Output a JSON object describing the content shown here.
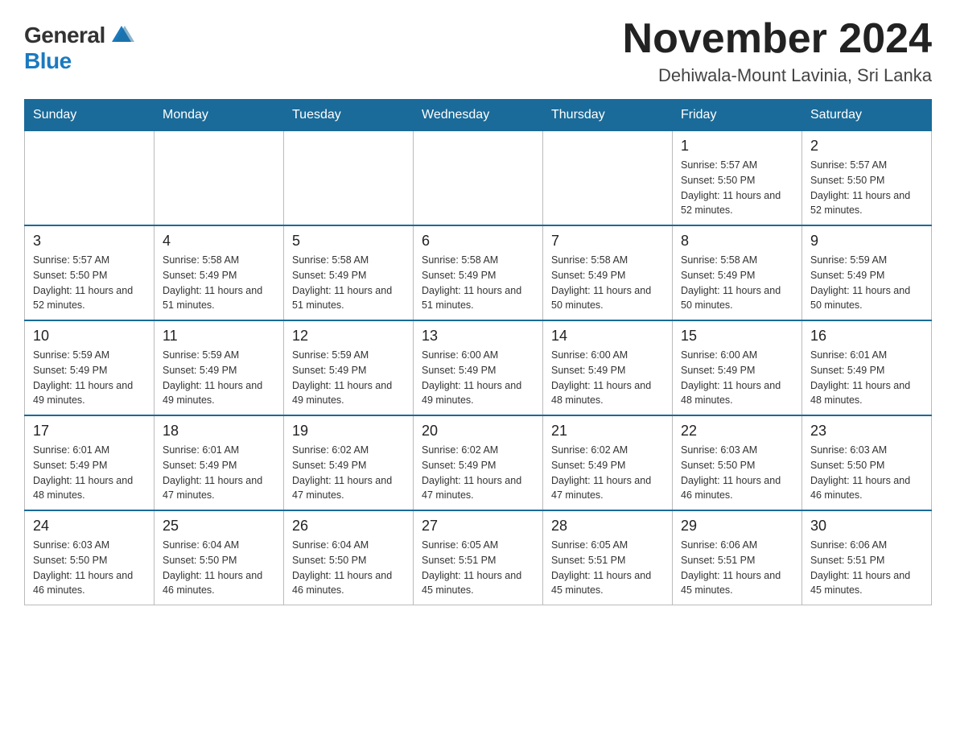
{
  "header": {
    "logo_general": "General",
    "logo_blue": "Blue",
    "month_title": "November 2024",
    "location": "Dehiwala-Mount Lavinia, Sri Lanka"
  },
  "days_of_week": [
    "Sunday",
    "Monday",
    "Tuesday",
    "Wednesday",
    "Thursday",
    "Friday",
    "Saturday"
  ],
  "weeks": [
    [
      {
        "day": "",
        "info": ""
      },
      {
        "day": "",
        "info": ""
      },
      {
        "day": "",
        "info": ""
      },
      {
        "day": "",
        "info": ""
      },
      {
        "day": "",
        "info": ""
      },
      {
        "day": "1",
        "info": "Sunrise: 5:57 AM\nSunset: 5:50 PM\nDaylight: 11 hours and 52 minutes."
      },
      {
        "day": "2",
        "info": "Sunrise: 5:57 AM\nSunset: 5:50 PM\nDaylight: 11 hours and 52 minutes."
      }
    ],
    [
      {
        "day": "3",
        "info": "Sunrise: 5:57 AM\nSunset: 5:50 PM\nDaylight: 11 hours and 52 minutes."
      },
      {
        "day": "4",
        "info": "Sunrise: 5:58 AM\nSunset: 5:49 PM\nDaylight: 11 hours and 51 minutes."
      },
      {
        "day": "5",
        "info": "Sunrise: 5:58 AM\nSunset: 5:49 PM\nDaylight: 11 hours and 51 minutes."
      },
      {
        "day": "6",
        "info": "Sunrise: 5:58 AM\nSunset: 5:49 PM\nDaylight: 11 hours and 51 minutes."
      },
      {
        "day": "7",
        "info": "Sunrise: 5:58 AM\nSunset: 5:49 PM\nDaylight: 11 hours and 50 minutes."
      },
      {
        "day": "8",
        "info": "Sunrise: 5:58 AM\nSunset: 5:49 PM\nDaylight: 11 hours and 50 minutes."
      },
      {
        "day": "9",
        "info": "Sunrise: 5:59 AM\nSunset: 5:49 PM\nDaylight: 11 hours and 50 minutes."
      }
    ],
    [
      {
        "day": "10",
        "info": "Sunrise: 5:59 AM\nSunset: 5:49 PM\nDaylight: 11 hours and 49 minutes."
      },
      {
        "day": "11",
        "info": "Sunrise: 5:59 AM\nSunset: 5:49 PM\nDaylight: 11 hours and 49 minutes."
      },
      {
        "day": "12",
        "info": "Sunrise: 5:59 AM\nSunset: 5:49 PM\nDaylight: 11 hours and 49 minutes."
      },
      {
        "day": "13",
        "info": "Sunrise: 6:00 AM\nSunset: 5:49 PM\nDaylight: 11 hours and 49 minutes."
      },
      {
        "day": "14",
        "info": "Sunrise: 6:00 AM\nSunset: 5:49 PM\nDaylight: 11 hours and 48 minutes."
      },
      {
        "day": "15",
        "info": "Sunrise: 6:00 AM\nSunset: 5:49 PM\nDaylight: 11 hours and 48 minutes."
      },
      {
        "day": "16",
        "info": "Sunrise: 6:01 AM\nSunset: 5:49 PM\nDaylight: 11 hours and 48 minutes."
      }
    ],
    [
      {
        "day": "17",
        "info": "Sunrise: 6:01 AM\nSunset: 5:49 PM\nDaylight: 11 hours and 48 minutes."
      },
      {
        "day": "18",
        "info": "Sunrise: 6:01 AM\nSunset: 5:49 PM\nDaylight: 11 hours and 47 minutes."
      },
      {
        "day": "19",
        "info": "Sunrise: 6:02 AM\nSunset: 5:49 PM\nDaylight: 11 hours and 47 minutes."
      },
      {
        "day": "20",
        "info": "Sunrise: 6:02 AM\nSunset: 5:49 PM\nDaylight: 11 hours and 47 minutes."
      },
      {
        "day": "21",
        "info": "Sunrise: 6:02 AM\nSunset: 5:49 PM\nDaylight: 11 hours and 47 minutes."
      },
      {
        "day": "22",
        "info": "Sunrise: 6:03 AM\nSunset: 5:50 PM\nDaylight: 11 hours and 46 minutes."
      },
      {
        "day": "23",
        "info": "Sunrise: 6:03 AM\nSunset: 5:50 PM\nDaylight: 11 hours and 46 minutes."
      }
    ],
    [
      {
        "day": "24",
        "info": "Sunrise: 6:03 AM\nSunset: 5:50 PM\nDaylight: 11 hours and 46 minutes."
      },
      {
        "day": "25",
        "info": "Sunrise: 6:04 AM\nSunset: 5:50 PM\nDaylight: 11 hours and 46 minutes."
      },
      {
        "day": "26",
        "info": "Sunrise: 6:04 AM\nSunset: 5:50 PM\nDaylight: 11 hours and 46 minutes."
      },
      {
        "day": "27",
        "info": "Sunrise: 6:05 AM\nSunset: 5:51 PM\nDaylight: 11 hours and 45 minutes."
      },
      {
        "day": "28",
        "info": "Sunrise: 6:05 AM\nSunset: 5:51 PM\nDaylight: 11 hours and 45 minutes."
      },
      {
        "day": "29",
        "info": "Sunrise: 6:06 AM\nSunset: 5:51 PM\nDaylight: 11 hours and 45 minutes."
      },
      {
        "day": "30",
        "info": "Sunrise: 6:06 AM\nSunset: 5:51 PM\nDaylight: 11 hours and 45 minutes."
      }
    ]
  ]
}
